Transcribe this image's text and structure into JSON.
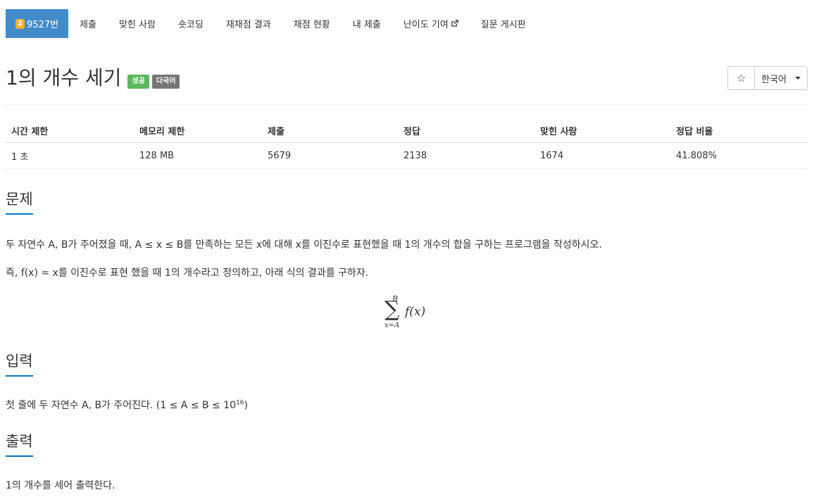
{
  "nav": {
    "tier_badge": "2",
    "problem_number": "9527번",
    "tabs": [
      "제출",
      "맞힌 사람",
      "숏코딩",
      "재채점 결과",
      "채점 현황",
      "내 제출",
      "난이도 기여",
      "질문 게시판"
    ]
  },
  "problem": {
    "title": "1의 개수 세기",
    "labels": [
      "성공",
      "다국어"
    ],
    "star_glyph": "☆",
    "language": "한국어"
  },
  "info_table": {
    "headers": [
      "시간 제한",
      "메모리 제한",
      "제출",
      "정답",
      "맞힌 사람",
      "정답 비율"
    ],
    "values": [
      "1 초",
      "128 MB",
      "5679",
      "2138",
      "1674",
      "41.808%"
    ]
  },
  "sections": {
    "description": {
      "heading": "문제",
      "line1": "두 자연수 A, B가 주어졌을 때, A ≤ x ≤ B를 만족하는 모든 x에 대해 x를 이진수로 표현했을 때 1의 개수의 합을 구하는 프로그램을 작성하시오.",
      "line2": "즉, f(x) = x를 이진수로 표현 했을 때 1의 개수라고 정의하고, 아래 식의 결과를 구하자.",
      "formula": {
        "upper": "B",
        "sigma": "∑",
        "lower": "x=A",
        "expr": "f(x)"
      }
    },
    "input": {
      "heading": "입력",
      "text_before": "첫 줄에 두 자연수 A, B가 주어진다. (1 ≤ A ≤ B ≤ 10",
      "exponent": "16",
      "text_after": ")"
    },
    "output": {
      "heading": "출력",
      "text": "1의 개수를 세어 출력한다."
    }
  },
  "colors": {
    "nav_active": "#428bca",
    "tier_gold": "#ffb028",
    "label_success": "#5cb85c",
    "label_default": "#777777",
    "section_underline": "#0076c0"
  },
  "icons": {
    "tier": "tier-gold-badge-icon",
    "external": "external-link-icon",
    "star": "star-outline-icon",
    "dropdown": "caret-down-icon"
  }
}
